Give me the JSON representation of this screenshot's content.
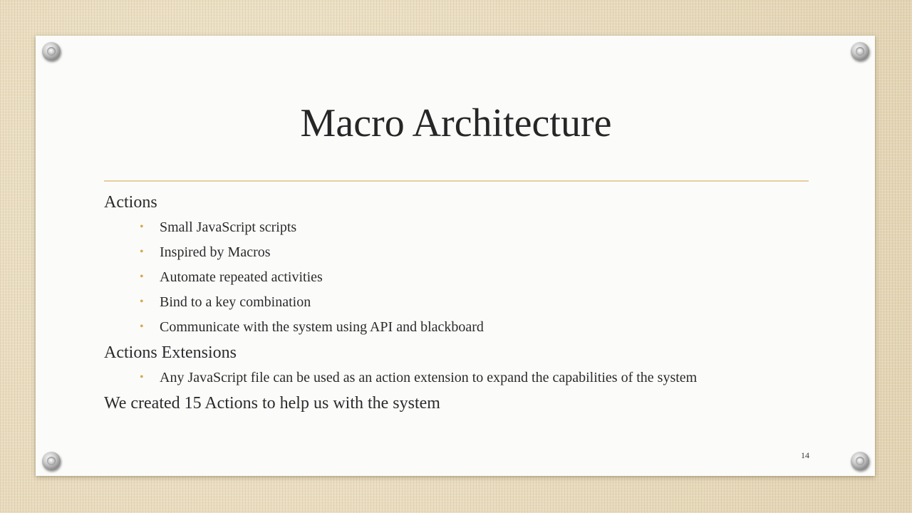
{
  "slide": {
    "title": "Macro Architecture",
    "page_number": "14",
    "bullet_glyph": "•",
    "accent_color": "#d6a84e",
    "rule_color": "#e6cf9d"
  },
  "content": {
    "sections": [
      {
        "heading": "Actions",
        "items": [
          "Small JavaScript scripts",
          "Inspired by Macros",
          "Automate repeated activities",
          "Bind to a key combination",
          "Communicate with the system using API and blackboard"
        ]
      },
      {
        "heading": "Actions Extensions",
        "items": [
          "Any JavaScript file can be used as an action extension to expand the capabilities of the system"
        ]
      },
      {
        "heading": "We created 15 Actions to help us with the system",
        "items": []
      }
    ]
  }
}
